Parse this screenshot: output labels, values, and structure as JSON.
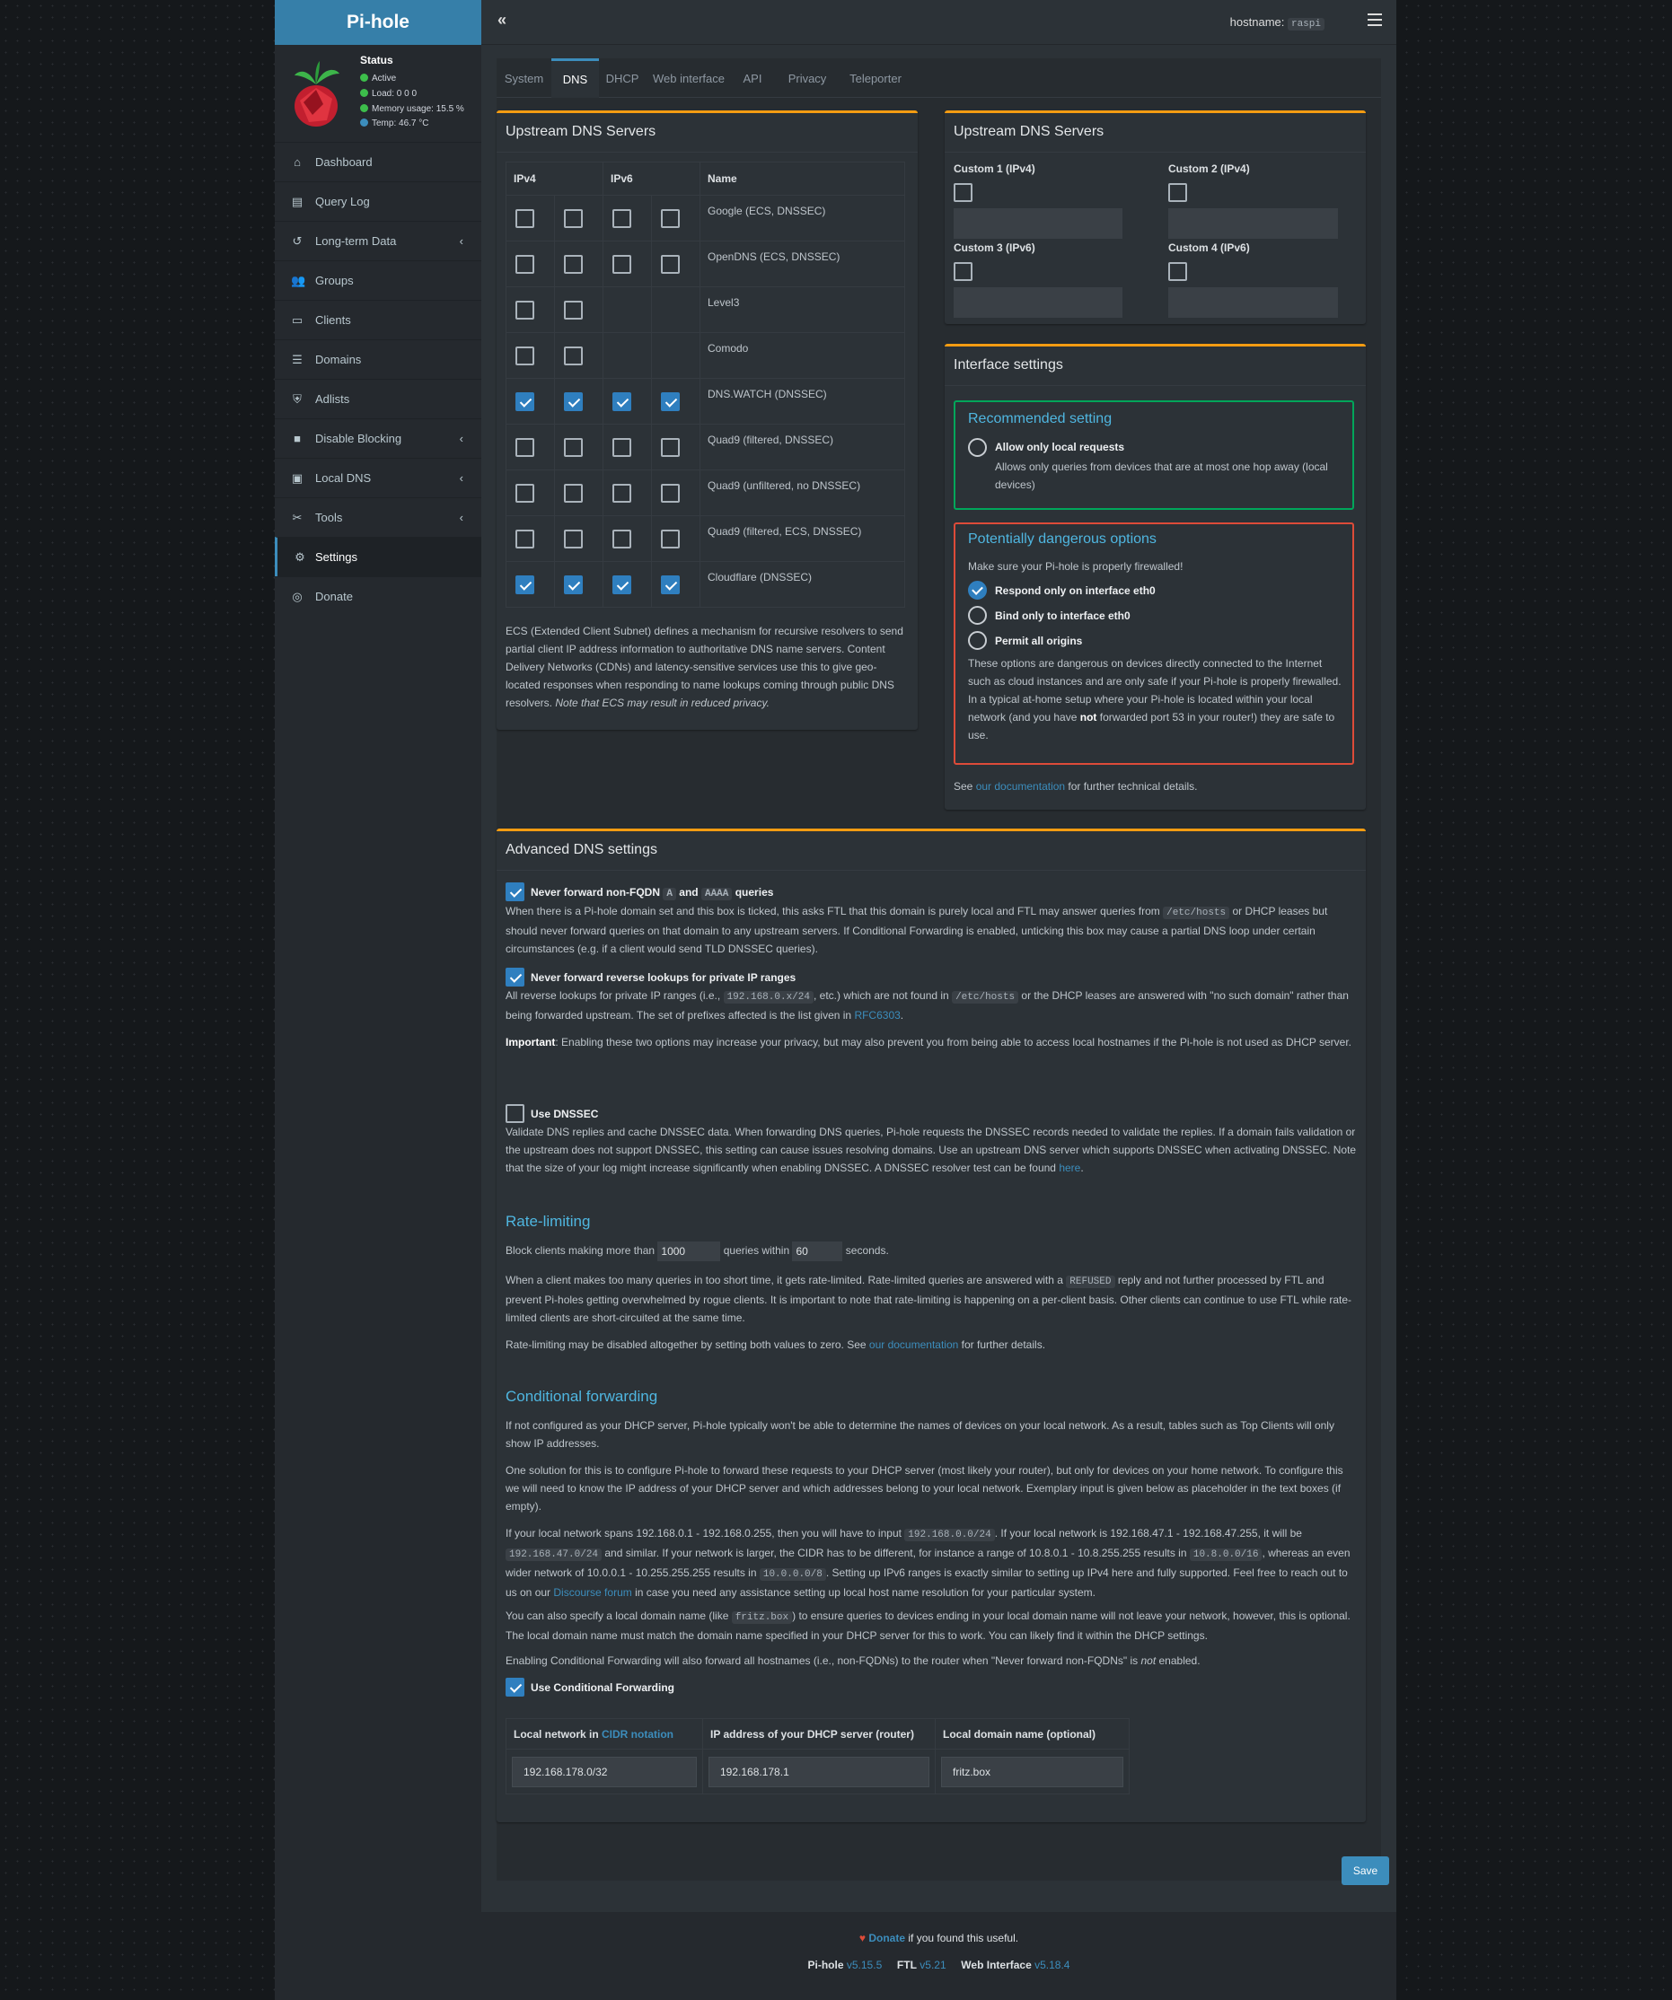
{
  "app": {
    "logo_text": "Pi-hole",
    "hostname_label": "hostname:",
    "hostname": "raspi"
  },
  "status": {
    "title": "Status",
    "active": "Active",
    "load": "Load:  0  0  0",
    "memory": "Memory usage:  15.5 %",
    "temp": "Temp: 46.7 °C"
  },
  "menu": [
    {
      "label": "Dashboard",
      "icon": "home-icon"
    },
    {
      "label": "Query Log",
      "icon": "file-icon"
    },
    {
      "label": "Long-term Data",
      "icon": "history-icon",
      "has_submenu": true
    },
    {
      "label": "Groups",
      "icon": "users-icon"
    },
    {
      "label": "Clients",
      "icon": "laptop-icon"
    },
    {
      "label": "Domains",
      "icon": "list-icon"
    },
    {
      "label": "Adlists",
      "icon": "shield-icon"
    },
    {
      "label": "Disable Blocking",
      "icon": "stop-icon",
      "has_submenu": true
    },
    {
      "label": "Local DNS",
      "icon": "address-book-icon",
      "has_submenu": true
    },
    {
      "label": "Tools",
      "icon": "tools-icon",
      "has_submenu": true
    },
    {
      "label": "Settings",
      "icon": "gear-icon",
      "active": true
    },
    {
      "label": "Donate",
      "icon": "donate-icon"
    }
  ],
  "tabs": [
    "System",
    "DNS",
    "DHCP",
    "Web interface",
    "API",
    "Privacy",
    "Teleporter"
  ],
  "active_tab": "DNS",
  "upstream": {
    "title": "Upstream DNS Servers",
    "headers": {
      "ipv4": "IPv4",
      "ipv6": "IPv6",
      "name": "Name"
    },
    "servers": [
      {
        "name": "Google (ECS, DNSSEC)",
        "v4": [
          false,
          false
        ],
        "v6": [
          false,
          false
        ]
      },
      {
        "name": "OpenDNS (ECS, DNSSEC)",
        "v4": [
          false,
          false
        ],
        "v6": [
          false,
          false
        ]
      },
      {
        "name": "Level3",
        "v4": [
          false,
          false
        ],
        "v6": null
      },
      {
        "name": "Comodo",
        "v4": [
          false,
          false
        ],
        "v6": null
      },
      {
        "name": "DNS.WATCH (DNSSEC)",
        "v4": [
          true,
          true
        ],
        "v6": [
          true,
          true
        ]
      },
      {
        "name": "Quad9 (filtered, DNSSEC)",
        "v4": [
          false,
          false
        ],
        "v6": [
          false,
          false
        ]
      },
      {
        "name": "Quad9 (unfiltered, no DNSSEC)",
        "v4": [
          false,
          false
        ],
        "v6": [
          false,
          false
        ]
      },
      {
        "name": "Quad9 (filtered, ECS, DNSSEC)",
        "v4": [
          false,
          false
        ],
        "v6": [
          false,
          false
        ]
      },
      {
        "name": "Cloudflare (DNSSEC)",
        "v4": [
          true,
          true
        ],
        "v6": [
          true,
          true
        ]
      }
    ],
    "ecs_text": "ECS (Extended Client Subnet) defines a mechanism for recursive resolvers to send partial client IP address information to authoritative DNS name servers. Content Delivery Networks (CDNs) and latency-sensitive services use this to give geo-located responses when responding to name lookups coming through public DNS resolvers.",
    "ecs_note": "Note that ECS may result in reduced privacy."
  },
  "custom": {
    "title": "Upstream DNS Servers",
    "c1": "Custom 1 (IPv4)",
    "c2": "Custom 2 (IPv4)",
    "c3": "Custom 3 (IPv6)",
    "c4": "Custom 4 (IPv6)"
  },
  "iface": {
    "title": "Interface settings",
    "rec_title": "Recommended setting",
    "local_label": "Allow only local requests",
    "local_desc": "Allows only queries from devices that are at most one hop away (local devices)",
    "danger_title": "Potentially dangerous options",
    "danger_intro": "Make sure your Pi-hole is properly firewalled!",
    "opt_eth0": "Respond only on interface eth0",
    "opt_bind": "Bind only to interface eth0",
    "opt_all": "Permit all origins",
    "danger_desc_1": "These options are dangerous on devices directly connected to the Internet such as cloud instances and are only safe if your Pi-hole is properly firewalled. In a typical at-home setup where your Pi-hole is located within your local network (and you have ",
    "danger_not": "not",
    "danger_desc_2": " forwarded port 53 in your router!) they are safe to use.",
    "see": "See ",
    "doc_link": "our documentation",
    "see_end": " for further technical details."
  },
  "advanced": {
    "title": "Advanced DNS settings",
    "fqdn_label_1": "Never forward non-FQDN ",
    "fqdn_a": "A",
    "fqdn_and": " and ",
    "fqdn_aaaa": "AAAA",
    "fqdn_label_2": " queries",
    "fqdn_desc_1": "When there is a Pi-hole domain set and this box is ticked, this asks FTL that this domain is purely local and FTL may answer queries from ",
    "fqdn_hosts": "/etc/hosts",
    "fqdn_desc_2": " or DHCP leases but should never forward queries on that domain to any upstream servers. If Conditional Forwarding is enabled, unticking this box may cause a partial DNS loop under certain circumstances (e.g. if a client would send TLD DNSSEC queries).",
    "rev_label": "Never forward reverse lookups for private IP ranges",
    "rev_desc_1": "All reverse lookups for private IP ranges (i.e., ",
    "rev_code1": "192.168.0.x/24",
    "rev_desc_2": ", etc.) which are not found in ",
    "rev_code2": "/etc/hosts",
    "rev_desc_3": " or the DHCP leases are answered with \"no such domain\" rather than being forwarded upstream. The set of prefixes affected is the list given in ",
    "rev_link": "RFC6303",
    "rev_desc_4": ".",
    "important_label": "Important",
    "important_text": ": Enabling these two options may increase your privacy, but may also prevent you from being able to access local hostnames if the Pi-hole is not used as DHCP server.",
    "dnssec_label": "Use DNSSEC",
    "dnssec_desc": "Validate DNS replies and cache DNSSEC data. When forwarding DNS queries, Pi-hole requests the DNSSEC records needed to validate the replies. If a domain fails validation or the upstream does not support DNSSEC, this setting can cause issues resolving domains. Use an upstream DNS server which supports DNSSEC when activating DNSSEC. Note that the size of your log might increase significantly when enabling DNSSEC. A DNSSEC resolver test can be found ",
    "dnssec_link": "here",
    "dnssec_end": ".",
    "rl_title": "Rate-limiting",
    "rl_pre": "Block clients making more than ",
    "rl_count": "1000",
    "rl_mid": " queries within ",
    "rl_interval": "60",
    "rl_post": " seconds.",
    "rl_desc_1": "When a client makes too many queries in too short time, it gets rate-limited. Rate-limited queries are answered with a ",
    "rl_refused": "REFUSED",
    "rl_desc_2": " reply and not further processed by FTL and prevent Pi-holes getting overwhelmed by rogue clients. It is important to note that rate-limiting is happening on a per-client basis. Other clients can continue to use FTL while rate-limited clients are short-circuited at the same time.",
    "rl_dis_1": "Rate-limiting may be disabled altogether by setting both values to zero. See ",
    "rl_dis_link": "our documentation",
    "rl_dis_2": " for further details.",
    "cf_title": "Conditional forwarding",
    "cf_p1": "If not configured as your DHCP server, Pi-hole typically won't be able to determine the names of devices on your local network. As a result, tables such as Top Clients will only show IP addresses.",
    "cf_p2": "One solution for this is to configure Pi-hole to forward these requests to your DHCP server (most likely your router), but only for devices on your home network. To configure this we will need to know the IP address of your DHCP server and which addresses belong to your local network. Exemplary input is given below as placeholder in the text boxes (if empty).",
    "cf_p3_a": "If your local network spans 192.168.0.1 - 192.168.0.255, then you will have to input ",
    "cf_p3_c1": "192.168.0.0/24",
    "cf_p3_b": ". If your local network is 192.168.47.1 - 192.168.47.255, it will be ",
    "cf_p3_c2": "192.168.47.0/24",
    "cf_p3_c": " and similar. If your network is larger, the CIDR has to be different, for instance a range of 10.8.0.1 - 10.8.255.255 results in ",
    "cf_p3_c3": "10.8.0.0/16",
    "cf_p3_d": ", whereas an even wider network of 10.0.0.1 - 10.255.255.255 results in ",
    "cf_p3_c4": "10.0.0.0/8",
    "cf_p3_e": ". Setting up IPv6 ranges is exactly similar to setting up IPv4 here and fully supported. Feel free to reach out to us on our ",
    "cf_p3_link": "Discourse forum",
    "cf_p3_f": " in case you need any assistance setting up local host name resolution for your particular system.",
    "cf_p4_a": "You can also specify a local domain name (like ",
    "cf_p4_code": "fritz.box",
    "cf_p4_b": ") to ensure queries to devices ending in your local domain name will not leave your network, however, this is optional. The local domain name must match the domain name specified in your DHCP server for this to work. You can likely find it within the DHCP settings.",
    "cf_p5_a": "Enabling Conditional Forwarding will also forward all hostnames (i.e., non-FQDNs) to the router when \"Never forward non-FQDNs\" is ",
    "cf_p5_not": "not",
    "cf_p5_b": " enabled.",
    "cf_use": "Use Conditional Forwarding",
    "cf_h1": "Local network in ",
    "cf_h1_link": "CIDR notation",
    "cf_h2": "IP address of your DHCP server (router)",
    "cf_h3": "Local domain name (optional)",
    "cf_network": "192.168.178.0/32",
    "cf_router": "192.168.178.1",
    "cf_domain": "fritz.box"
  },
  "save_label": "Save",
  "footer": {
    "donate": "Donate",
    "donate_rest": " if you found this useful.",
    "pihole_label": "Pi-hole",
    "pihole_ver": "v5.15.5",
    "ftl_label": "FTL",
    "ftl_ver": "v5.21",
    "web_label": "Web Interface",
    "web_ver": "v5.18.4"
  },
  "colors": {
    "accent": "#3c8dbc",
    "box_border": "#f39c12",
    "recommended": "#00a65a",
    "danger": "#dd4b39",
    "logo_bg": "#367fa9"
  }
}
